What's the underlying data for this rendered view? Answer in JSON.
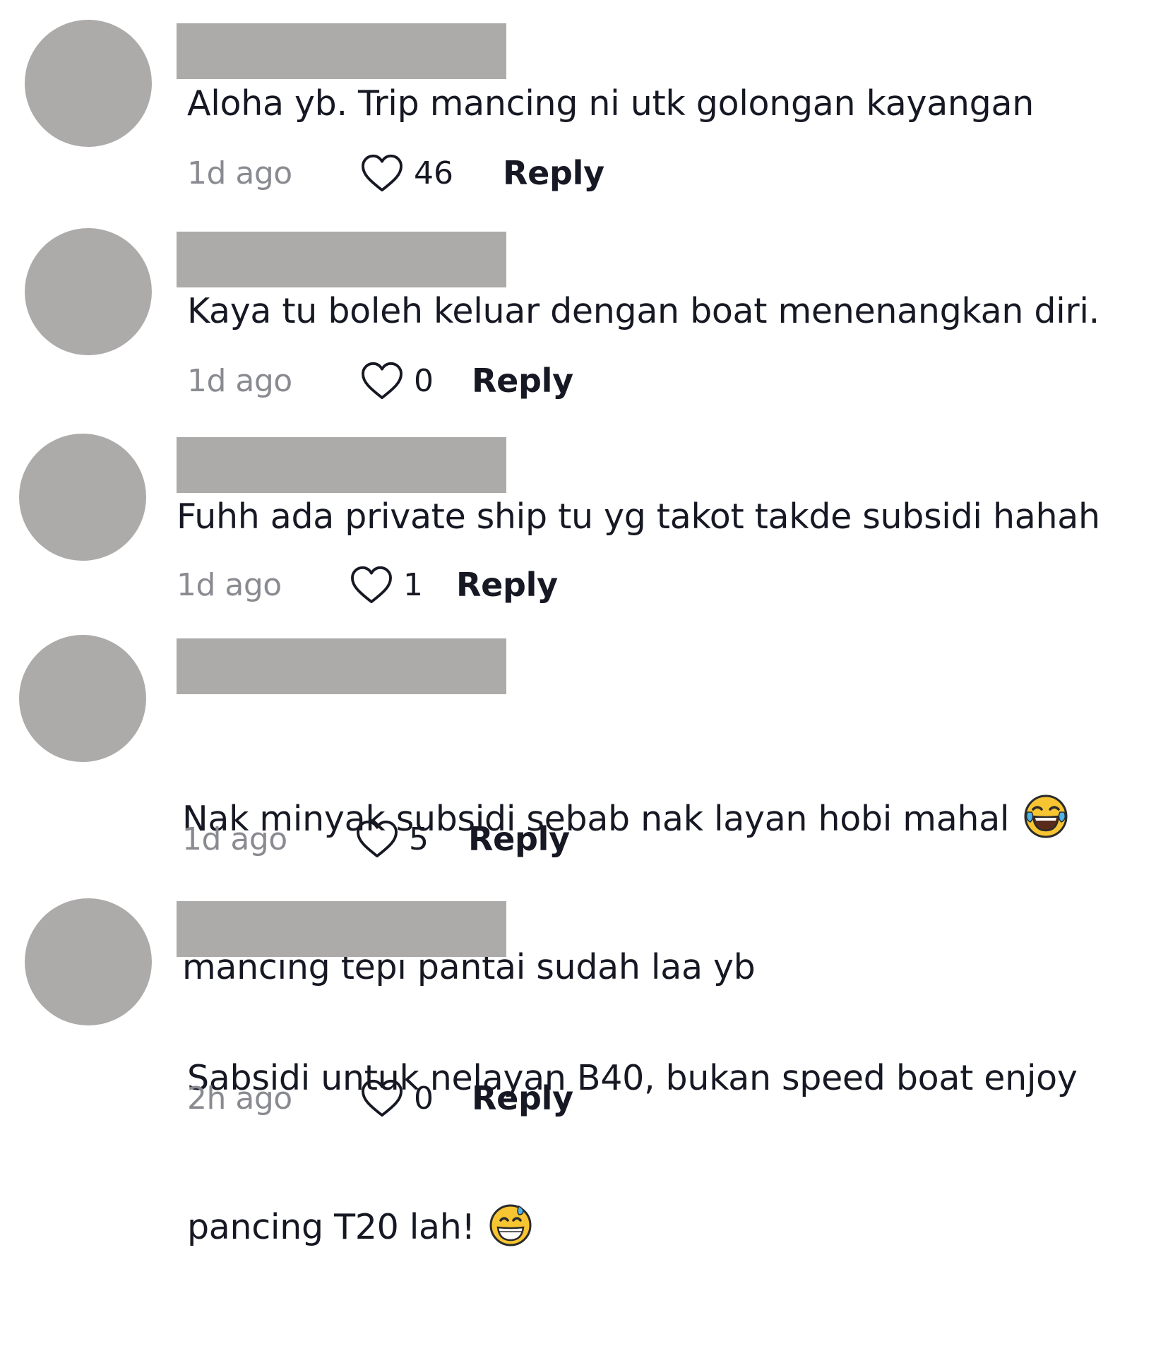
{
  "comments": [
    {
      "text": "Aloha yb. Trip mancing ni utk golongan kayangan",
      "time": "1d ago",
      "likes": "46",
      "reply_label": "Reply"
    },
    {
      "text": "Kaya tu boleh keluar dengan boat menenangkan diri.",
      "time": "1d ago",
      "likes": "0",
      "reply_label": "Reply"
    },
    {
      "text": "Fuhh ada private ship tu yg takot takde subsidi hahah",
      "time": "1d ago",
      "likes": "1",
      "reply_label": "Reply"
    },
    {
      "text_line1": "Nak minyak subsidi sebab nak layan hobi mahal",
      "text_line2": "mancing tepi pantai sudah laa yb",
      "emoji": "face-with-tears-of-joy",
      "time": "1d ago",
      "likes": "5",
      "reply_label": "Reply"
    },
    {
      "text_line1": "Sabsidi untuk nelayan B40, bukan speed boat enjoy",
      "text_line2": "pancing T20 lah!",
      "emoji": "grinning-face-with-sweat",
      "time": "2h ago",
      "likes": "0",
      "reply_label": "Reply"
    }
  ],
  "colors": {
    "placeholder_gray": "#adaaaa",
    "text": "#161823",
    "muted": "#8a8b91"
  }
}
